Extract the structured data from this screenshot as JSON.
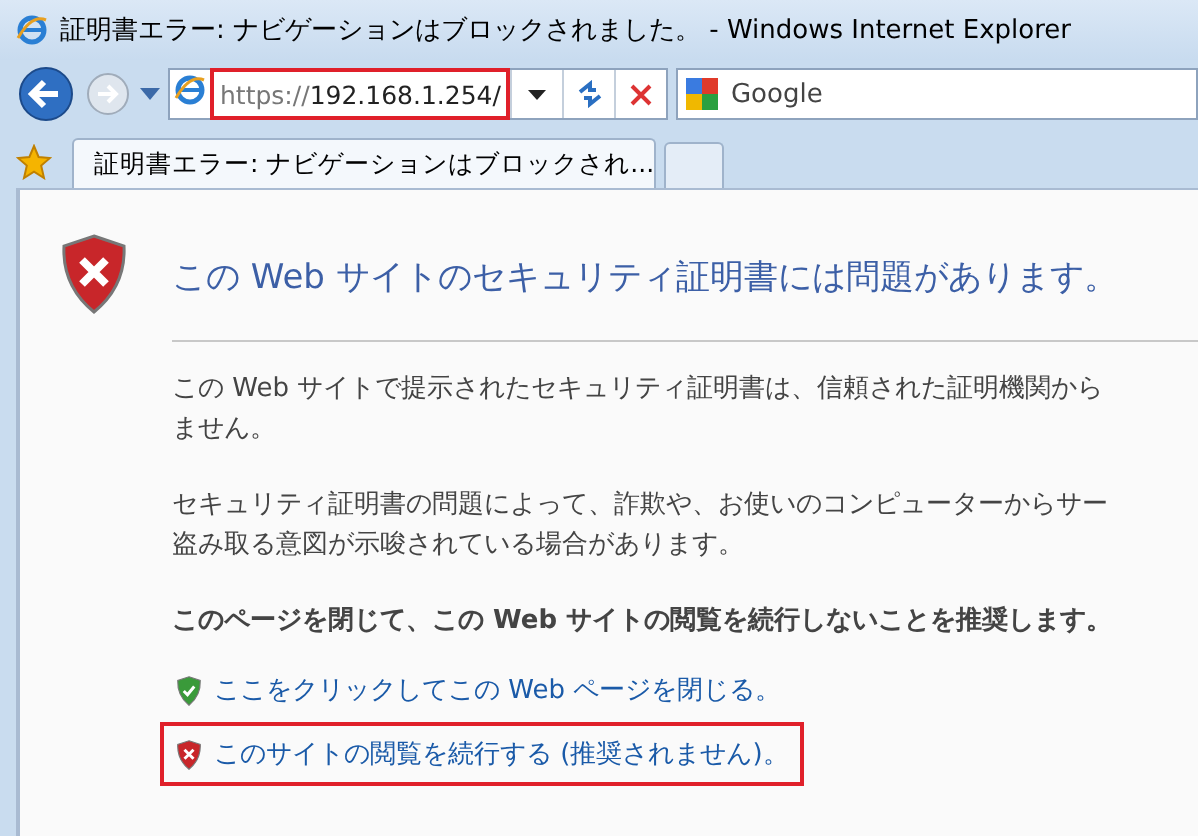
{
  "window": {
    "title": "証明書エラー: ナビゲーションはブロックされました。 - Windows Internet Explorer"
  },
  "address_bar": {
    "scheme": "https://",
    "host": "192.168.1.254/",
    "highlighted": true
  },
  "search": {
    "provider": "Google"
  },
  "tabs": [
    {
      "label": "証明書エラー: ナビゲーションはブロックされ...",
      "selected": true
    }
  ],
  "page": {
    "heading": "この Web サイトのセキュリティ証明書には問題があります。",
    "paragraphs": [
      [
        "この Web サイトで提示されたセキュリティ証明書は、信頼された証明機関から",
        "ません。"
      ],
      [
        "セキュリティ証明書の問題によって、詐欺や、お使いのコンピューターからサー",
        "盗み取る意図が示唆されている場合があります。"
      ]
    ],
    "recommendation": "このページを閉じて、この Web サイトの閲覧を続行しないことを推奨します。",
    "links": [
      {
        "kind": "safe",
        "label": "ここをクリックしてこの Web ページを閉じる。",
        "highlighted": false
      },
      {
        "kind": "unsafe",
        "label": "このサイトの閲覧を続行する (推奨されません)。",
        "highlighted": true
      }
    ]
  }
}
